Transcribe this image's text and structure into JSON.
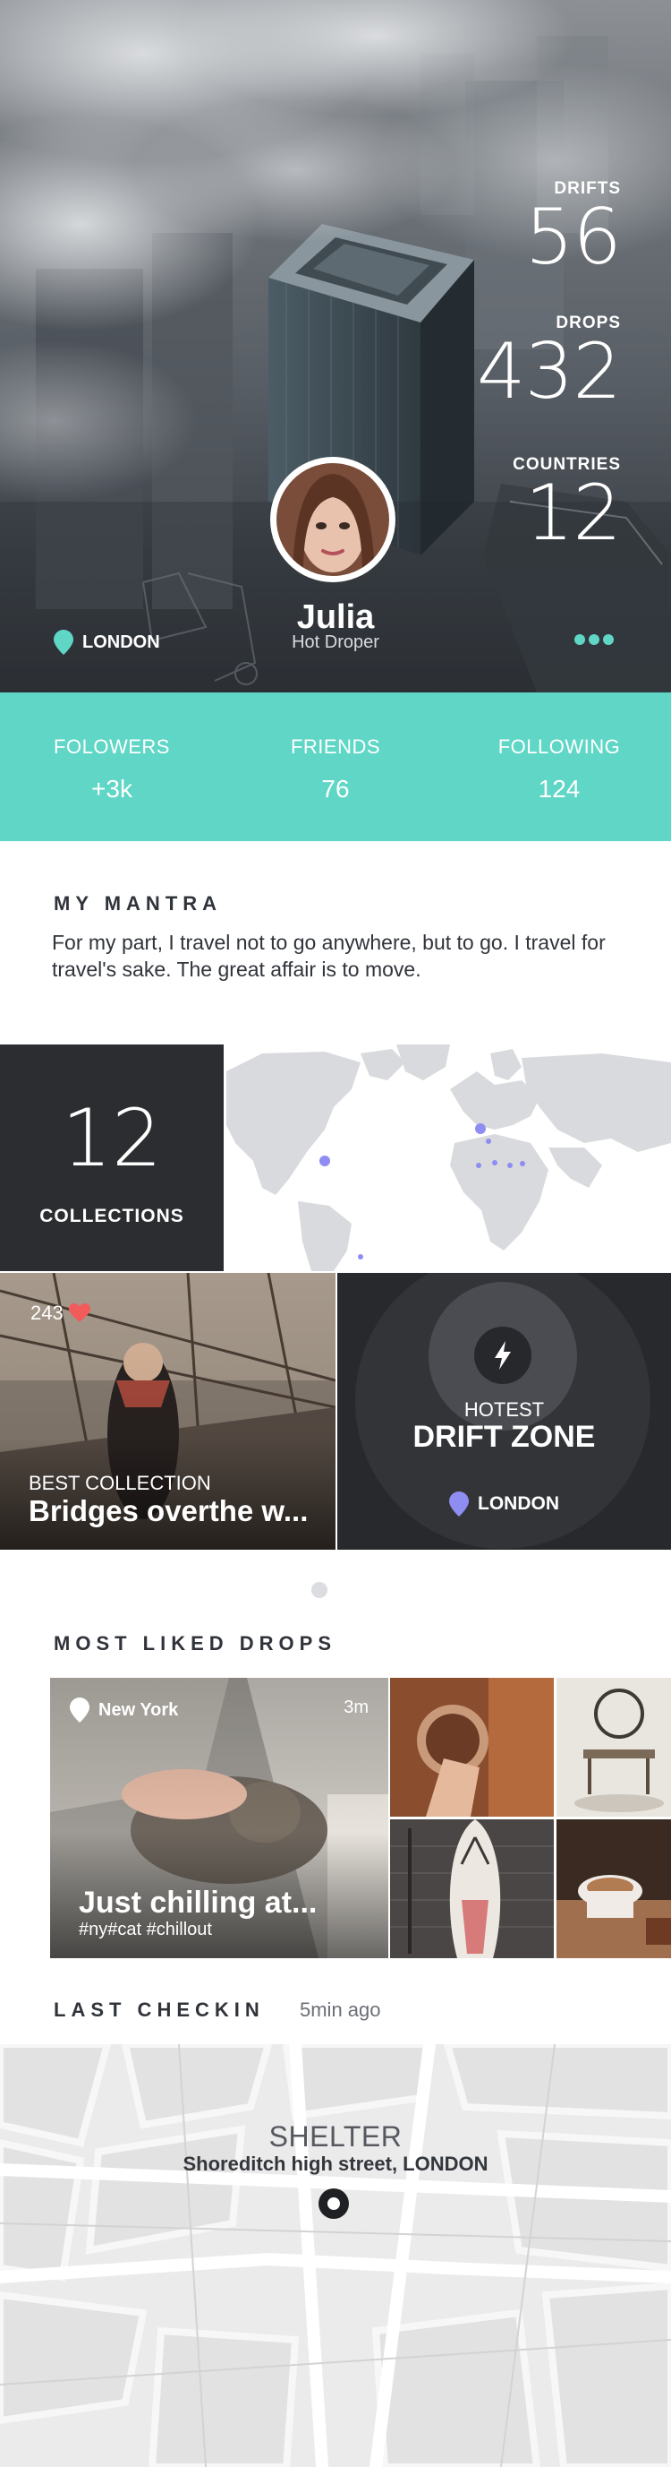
{
  "hero": {
    "stats": [
      {
        "label": "DRIFTS",
        "value": "56"
      },
      {
        "label": "DROPS",
        "value": "432"
      },
      {
        "label": "COUNTRIES",
        "value": "12"
      }
    ],
    "name": "Julia",
    "role": "Hot Droper",
    "location": "LONDON"
  },
  "social": [
    {
      "label": "FOLOWERS",
      "value": "+3k"
    },
    {
      "label": "FRIENDS",
      "value": "76"
    },
    {
      "label": "FOLLOWING",
      "value": "124"
    }
  ],
  "mantra": {
    "title": "MY MANTRA",
    "text": "For my part, I travel not to go anywhere, but to go. I travel for travel's sake. The great affair is to move."
  },
  "collections": {
    "count": "12",
    "label": "COLLECTIONS"
  },
  "best_collection": {
    "likes": "243",
    "label": "BEST COLLECTION",
    "title": "Bridges overthe w..."
  },
  "hotest": {
    "label": "HOTEST",
    "title": "DRIFT ZONE",
    "location": "LONDON"
  },
  "most_liked": {
    "title": "MOST LIKED DROPS",
    "main": {
      "city": "New York",
      "time": "3m",
      "title": "Just chilling at...",
      "tags": "#ny#cat #chillout"
    }
  },
  "last_checkin": {
    "title": "LAST CHECKIN",
    "ago": "5min ago",
    "place": "SHELTER",
    "address": "Shoreditch high street, LONDON"
  },
  "colors": {
    "accent": "#5fd6c6",
    "dark": "#2b2d30",
    "map_dot": "#8f8cf2",
    "heart": "#f25b5b"
  }
}
